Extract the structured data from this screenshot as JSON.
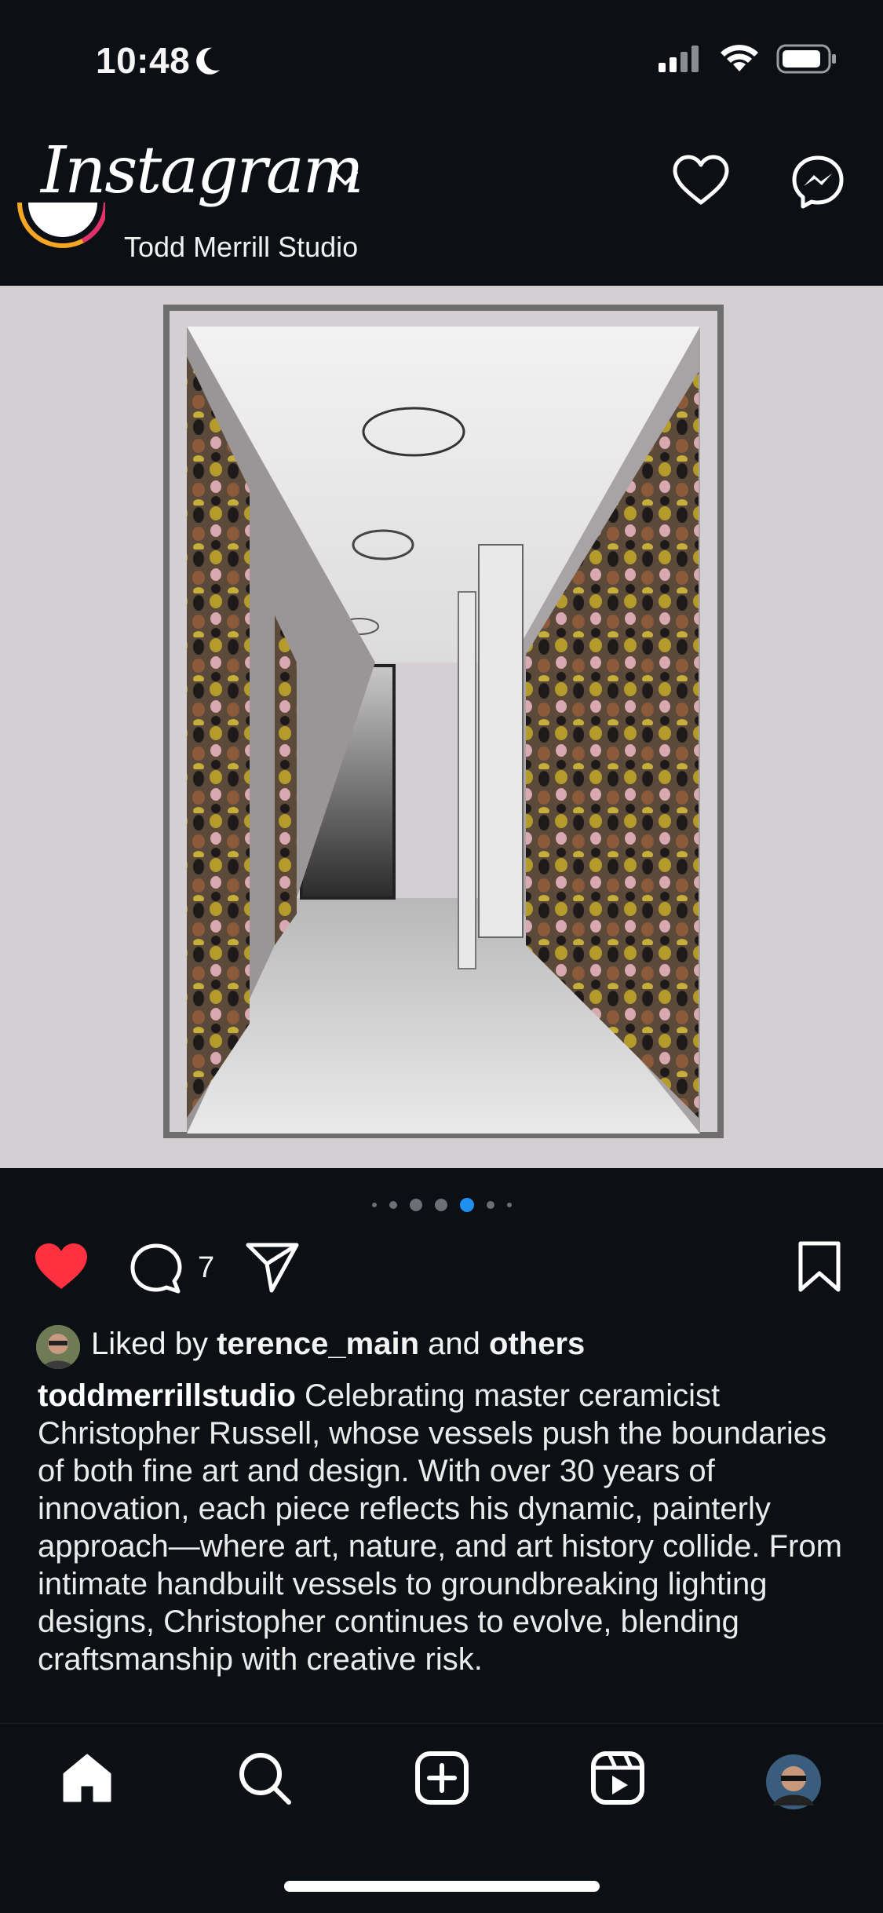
{
  "status_bar": {
    "time": "10:48",
    "icons": [
      "moon-icon",
      "cellular-signal-icon",
      "wifi-icon",
      "battery-icon"
    ]
  },
  "header": {
    "app_name": "Instagram",
    "icons": [
      "chevron-down-icon",
      "heart-icon",
      "messenger-icon"
    ]
  },
  "post": {
    "author": "Todd Merrill Studio",
    "image_alt": "Sketch of a corridor lined with ceramic vessel walls",
    "carousel": {
      "count": 7,
      "active_index": 4
    },
    "actions": {
      "liked": true,
      "comment_count": "7"
    },
    "liked_by": {
      "prefix": "Liked by",
      "user": "terence_main",
      "middle": "and",
      "suffix": "others"
    },
    "caption": {
      "username": "toddmerrillstudio",
      "text": "Celebrating master ceramicist Christopher Russell, whose vessels push the boundaries of both fine art and design. With over 30 years of innovation, each piece reflects his dynamic, painterly approach—where art, nature, and art history collide. From intimate handbuilt vessels to groundbreaking lighting designs, Christopher continues to evolve, blending craftsmanship with creative risk."
    }
  },
  "tab_bar": {
    "items": [
      "home-icon",
      "search-icon",
      "create-icon",
      "reels-icon",
      "profile-avatar"
    ]
  },
  "colors": {
    "background": "#0c0f14",
    "like_red": "#ff3040",
    "accent_blue": "#1f8ff0"
  }
}
